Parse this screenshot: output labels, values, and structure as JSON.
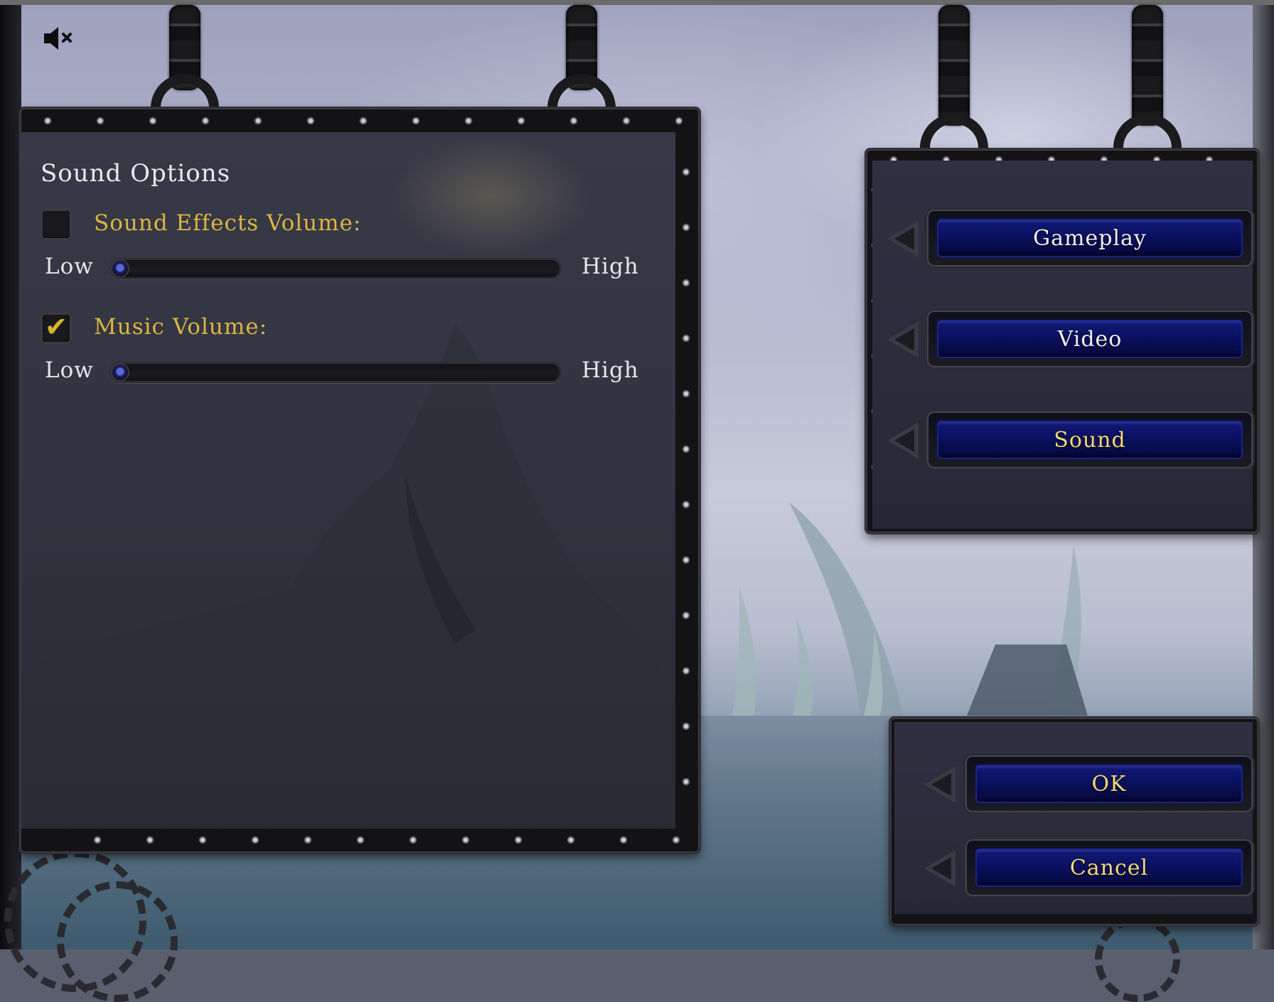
{
  "audio_toggle": {
    "icon": "speaker-muted-icon"
  },
  "sound_options": {
    "title": "Sound Options",
    "sound_effects": {
      "label": "Sound Effects Volume:",
      "enabled": false,
      "low_label": "Low",
      "high_label": "High",
      "level_percent": 0
    },
    "music": {
      "label": "Music Volume:",
      "enabled": true,
      "low_label": "Low",
      "high_label": "High",
      "level_percent": 0
    }
  },
  "menu": {
    "gameplay_label": "Gameplay",
    "video_label": "Video",
    "sound_label": "Sound"
  },
  "dialog": {
    "ok_label": "OK",
    "cancel_label": "Cancel"
  },
  "colors": {
    "label_gold": "#d9b643",
    "button_blue": "#0b1060",
    "button_text_gold": "#f2d978"
  }
}
